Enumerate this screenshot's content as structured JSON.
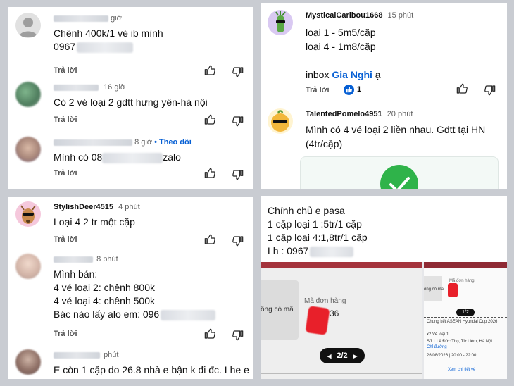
{
  "colors": {
    "link": "#065fd4",
    "like_blue": "#065fd4",
    "red_scribble": "#e8202a"
  },
  "panel_tl": {
    "c1": {
      "time": "giờ",
      "text1": "Chênh 400k/1 vé ib mình",
      "text2": "0967",
      "reply": "Trả lời"
    },
    "c2": {
      "time": "16 giờ",
      "text": "Có 2 vé loại 2 gdtt hưng yên-hà nội",
      "reply": "Trả lời"
    },
    "c3": {
      "time": "8 giờ",
      "follow": "• Theo dõi",
      "text_a": "Mình có 08",
      "text_b": "zalo",
      "reply": "Trả lời"
    }
  },
  "panel_tr": {
    "c1": {
      "user": "MysticalCaribou1668",
      "time": "15 phút",
      "l1": "loại 1 - 5m5/cặp",
      "l2": "loại 4 - 1m8/cặp",
      "l3a": "inbox ",
      "l3b": "Gia Nghi",
      "l3c": " ạ",
      "reply": "Trả lời",
      "likes": "1"
    },
    "c2": {
      "user": "TalentedPomelo4951",
      "time": "20 phút",
      "l1": "Mình có 4 vé loại 2 liền nhau. Gdtt tại HN",
      "l2": "(4tr/cặp)"
    }
  },
  "panel_bl": {
    "c1": {
      "user": "StylishDeer4515",
      "time": "4 phút",
      "text": "Loại 4 2 tr một cặp",
      "reply": "Trả lời"
    },
    "c2": {
      "time": "8 phút",
      "l1": "Mình bán:",
      "l2": "4 vé loại 2: chênh 800k",
      "l3": "4 vé loại 4: chênh 500k",
      "l4": "Bác nào lấy alo em: 096",
      "reply": "Trả lời"
    },
    "c3": {
      "time": "phút",
      "text": "E còn 1 cặp do 26.8 nhà e bận k đi đc. Lhe e"
    }
  },
  "panel_br": {
    "l1": "Chính chủ e pasa",
    "l2": "1 cặp loại 1 :5tr/1 cặp",
    "l3": "1 cặp loại 4:1,8tr/1 cặp",
    "l4": "Lh : 0967",
    "shot": {
      "left_label": "ồng có mã",
      "mid_label": "Mã đơn hàng",
      "mid_value": "36",
      "pager": "2/2",
      "right_code": "ông có mã",
      "right_order": "Mã đơn hàng",
      "right_pager": "1/2",
      "event_title": "Chung kết ASEAN Hyundai Cup 2026",
      "ticket": "x2 Vé loại 1",
      "address": "Số 1 Lê Đức Thọ, Từ Liêm, Hà Nội",
      "directions": "Chỉ đường",
      "date": "26/08/2026 | 20:00 - 22:00",
      "details": "Xem chi tiết vé"
    }
  }
}
